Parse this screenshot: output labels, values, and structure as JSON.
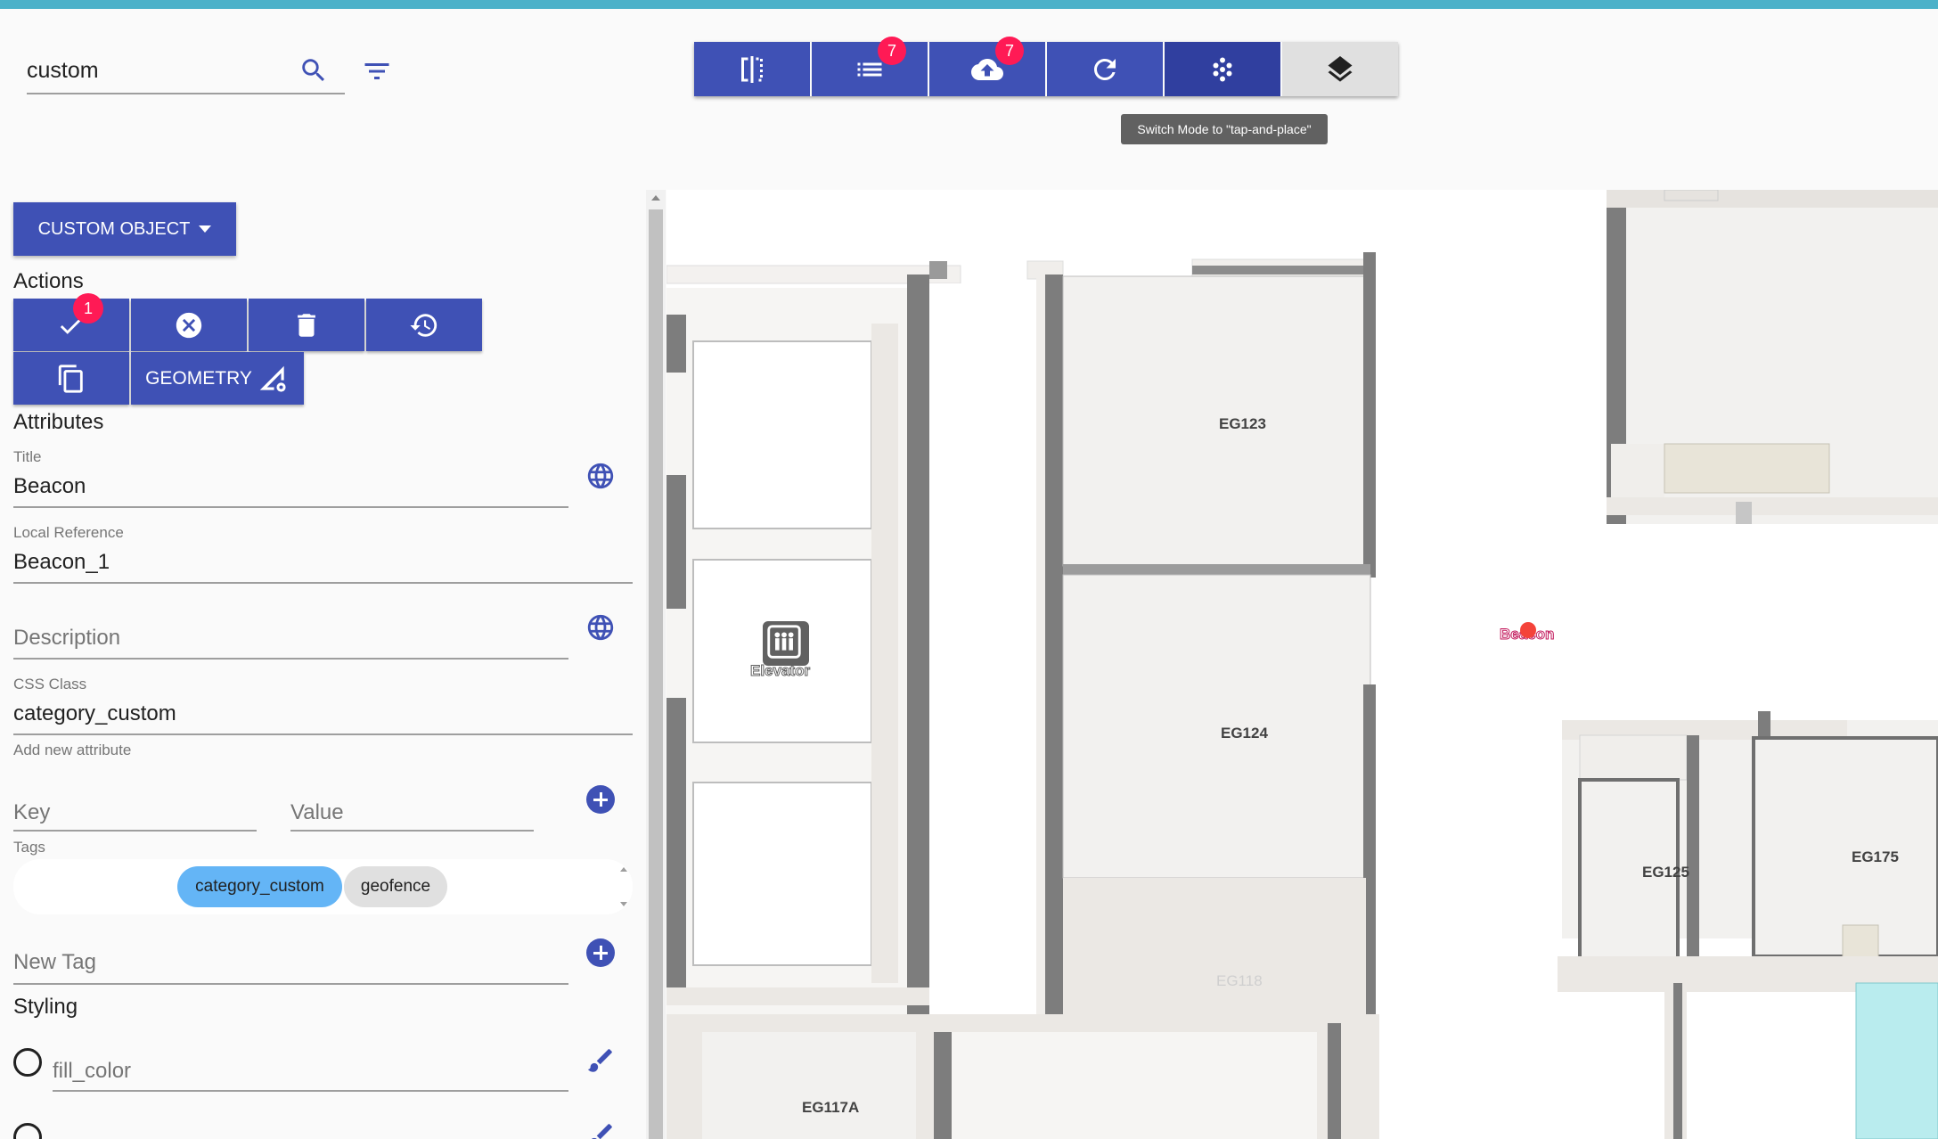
{
  "search": {
    "value": "custom"
  },
  "toolbar": {
    "list_badge": "7",
    "upload_badge": "7",
    "tooltip": "Switch Mode to \"tap-and-place\""
  },
  "panel": {
    "object_type": "CUSTOM OBJECT",
    "actions_heading": "Actions",
    "save_badge": "1",
    "geometry_label": "GEOMETRY",
    "attributes_heading": "Attributes",
    "fields": {
      "title_label": "Title",
      "title_value": "Beacon",
      "local_ref_label": "Local Reference",
      "local_ref_value": "Beacon_1",
      "description_placeholder": "Description",
      "css_class_label": "CSS Class",
      "css_class_value": "category_custom",
      "add_attribute_label": "Add new attribute",
      "key_placeholder": "Key",
      "value_placeholder": "Value",
      "tags_label": "Tags",
      "new_tag_placeholder": "New Tag"
    },
    "tags": [
      "category_custom",
      "geofence"
    ],
    "styling_heading": "Styling",
    "styling_fields": [
      "fill_color"
    ]
  },
  "map": {
    "rooms": [
      "EG123",
      "EG124",
      "EG125",
      "EG175",
      "EG118",
      "EG117A"
    ],
    "elevator_label": "Elevator",
    "beacon_label": "Beacon"
  },
  "colors": {
    "primary": "#3f51b5",
    "primary_dark": "#303f9f",
    "badge": "#ff1a55",
    "chip": "#64b5f6",
    "topbar": "#4cb1c9"
  }
}
